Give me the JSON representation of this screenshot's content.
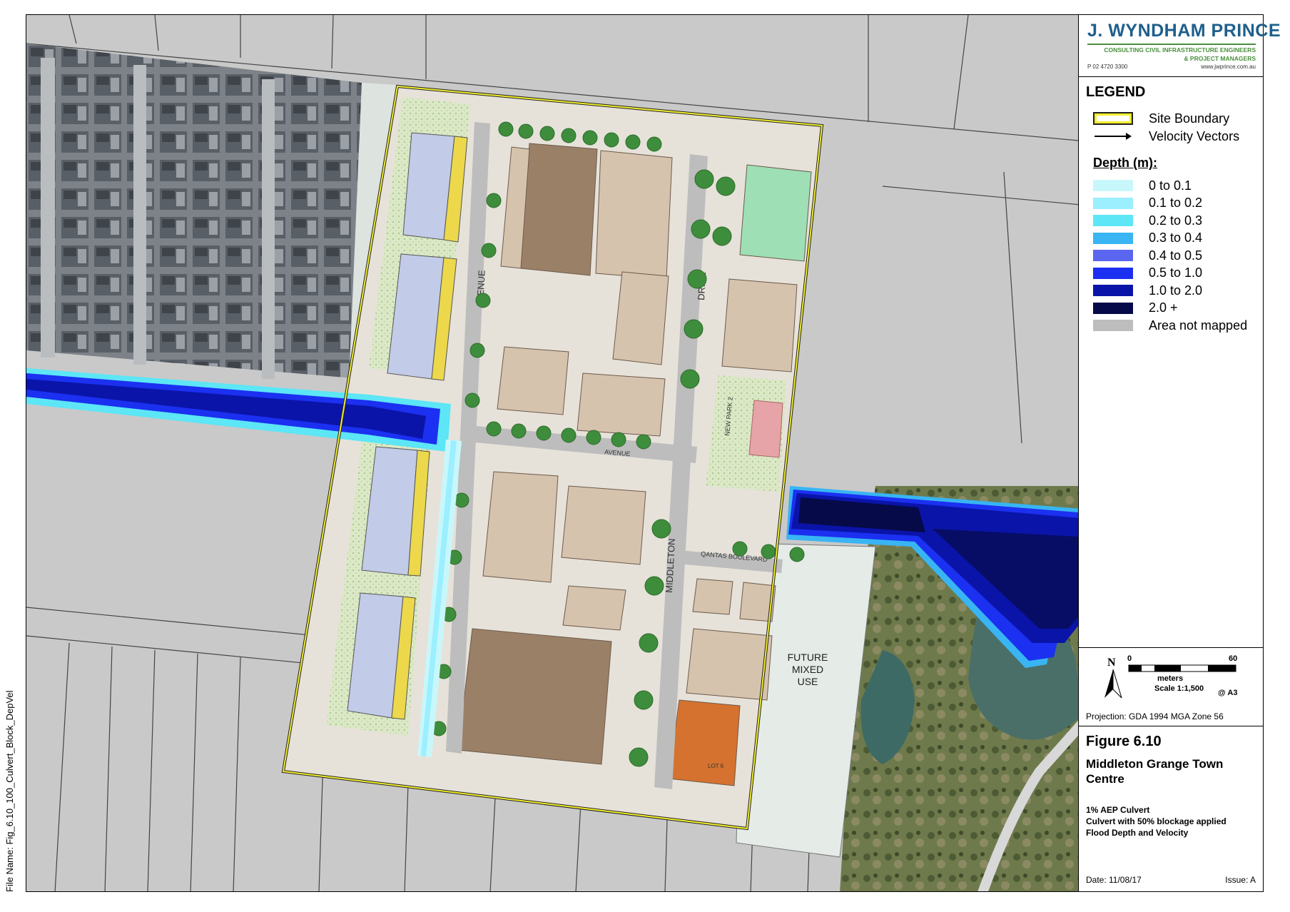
{
  "file_name": "File Name: Fig_6.10_100_Culvert_Block_DepVel",
  "logo": {
    "name": "J. WYNDHAM PRINCE",
    "line1": "CONSULTING CIVIL INFRASTRUCTURE ENGINEERS",
    "line2": "& PROJECT MANAGERS",
    "phone": "P 02 4720 3300",
    "web": "www.jwprince.com.au"
  },
  "legend": {
    "title": "LEGEND",
    "site_boundary": "Site Boundary",
    "velocity_vectors": "Velocity Vectors",
    "depth_title": "Depth (m):",
    "classes": [
      {
        "label": "0 to 0.1",
        "color": "#c8f7fb"
      },
      {
        "label": "0.1 to 0.2",
        "color": "#9befff"
      },
      {
        "label": "0.2 to 0.3",
        "color": "#5ce6f6"
      },
      {
        "label": "0.3 to 0.4",
        "color": "#38b5f2"
      },
      {
        "label": "0.4 to 0.5",
        "color": "#5a66ef"
      },
      {
        "label": "0.5 to 1.0",
        "color": "#1b30f0"
      },
      {
        "label": "1.0 to 2.0",
        "color": "#0a14a8"
      },
      {
        "label": "2.0 +",
        "color": "#060a48"
      },
      {
        "label": "Area not mapped",
        "color": "#bdbdbd"
      }
    ]
  },
  "scale": {
    "north": "N",
    "tick_start": "0",
    "tick_end": "60",
    "units": "meters",
    "ratio": "Scale 1:1,500",
    "paper": "@ A3",
    "projection": "Projection: GDA 1994 MGA Zone 56"
  },
  "figure": {
    "number": "Figure 6.10",
    "title": "Middleton Grange Town Centre",
    "desc": [
      "1% AEP Culvert",
      "Culvert with 50% blockage applied",
      "Flood Depth and Velocity"
    ],
    "date": "Date: 11/08/17",
    "issue": "Issue: A"
  },
  "map_labels": {
    "future_mixed_use": [
      "FUTURE",
      "MIXED",
      "USE"
    ],
    "avenue": "AVENUE",
    "drive": "DRIVE",
    "middleton": "MIDDLETON",
    "avenue_east": "AVENUE",
    "qantas": "QANTAS BOULEVARD",
    "new_park": "NEW PARK 2",
    "lot6": "LOT 6"
  }
}
